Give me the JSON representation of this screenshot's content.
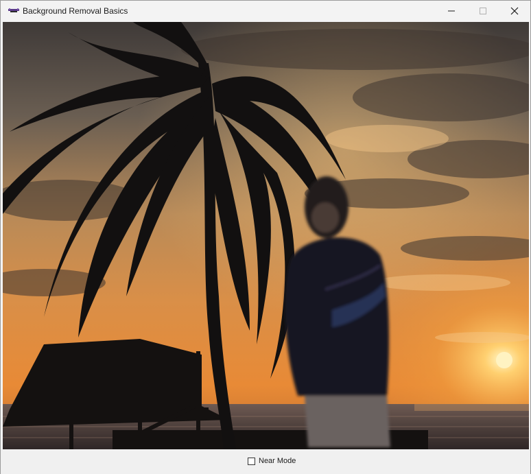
{
  "window": {
    "title": "Background Removal Basics",
    "controls": {
      "minimize": "minimize-icon",
      "maximize": "maximize-icon",
      "close": "close-icon"
    }
  },
  "scene": {
    "description_icon": "composited-image",
    "sky_colors": {
      "top": "#4a4440",
      "mid": "#c28a4c",
      "low": "#e89a3e",
      "sun": "#ffe89a",
      "sea": "#5a4a48"
    },
    "silhouette_color": "#121010",
    "person_color": "#1a1a22"
  },
  "footer": {
    "near_mode_label": "Near Mode",
    "near_mode_checked": false
  }
}
